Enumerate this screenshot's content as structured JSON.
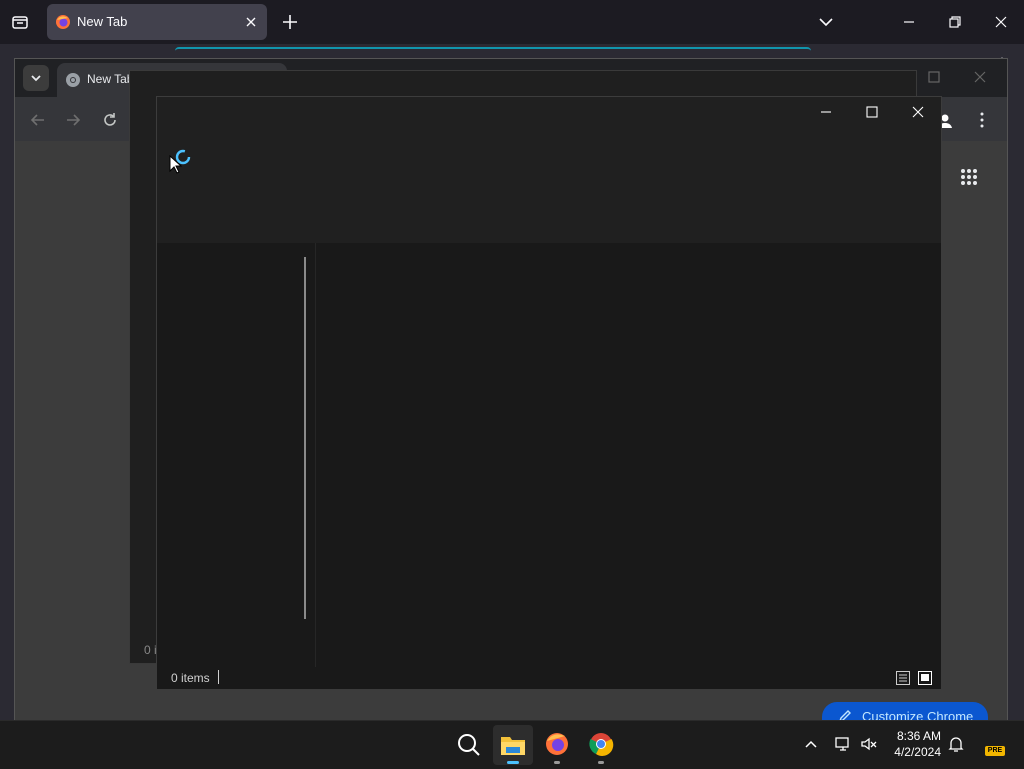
{
  "firefox": {
    "tab_title": "New Tab"
  },
  "chrome": {
    "tab_title": "New Tab",
    "customize_label": "Customize Chrome"
  },
  "background_window": {
    "status_fragment": "0 i"
  },
  "dialog": {
    "status_items": "0 items"
  },
  "taskbar": {
    "time": "8:36 AM",
    "date": "4/2/2024",
    "pre_badge": "PRE"
  },
  "colors": {
    "accent": "#0b57d0",
    "firefox_glow": "#00ddff",
    "spinner": "#4cc2ff"
  }
}
